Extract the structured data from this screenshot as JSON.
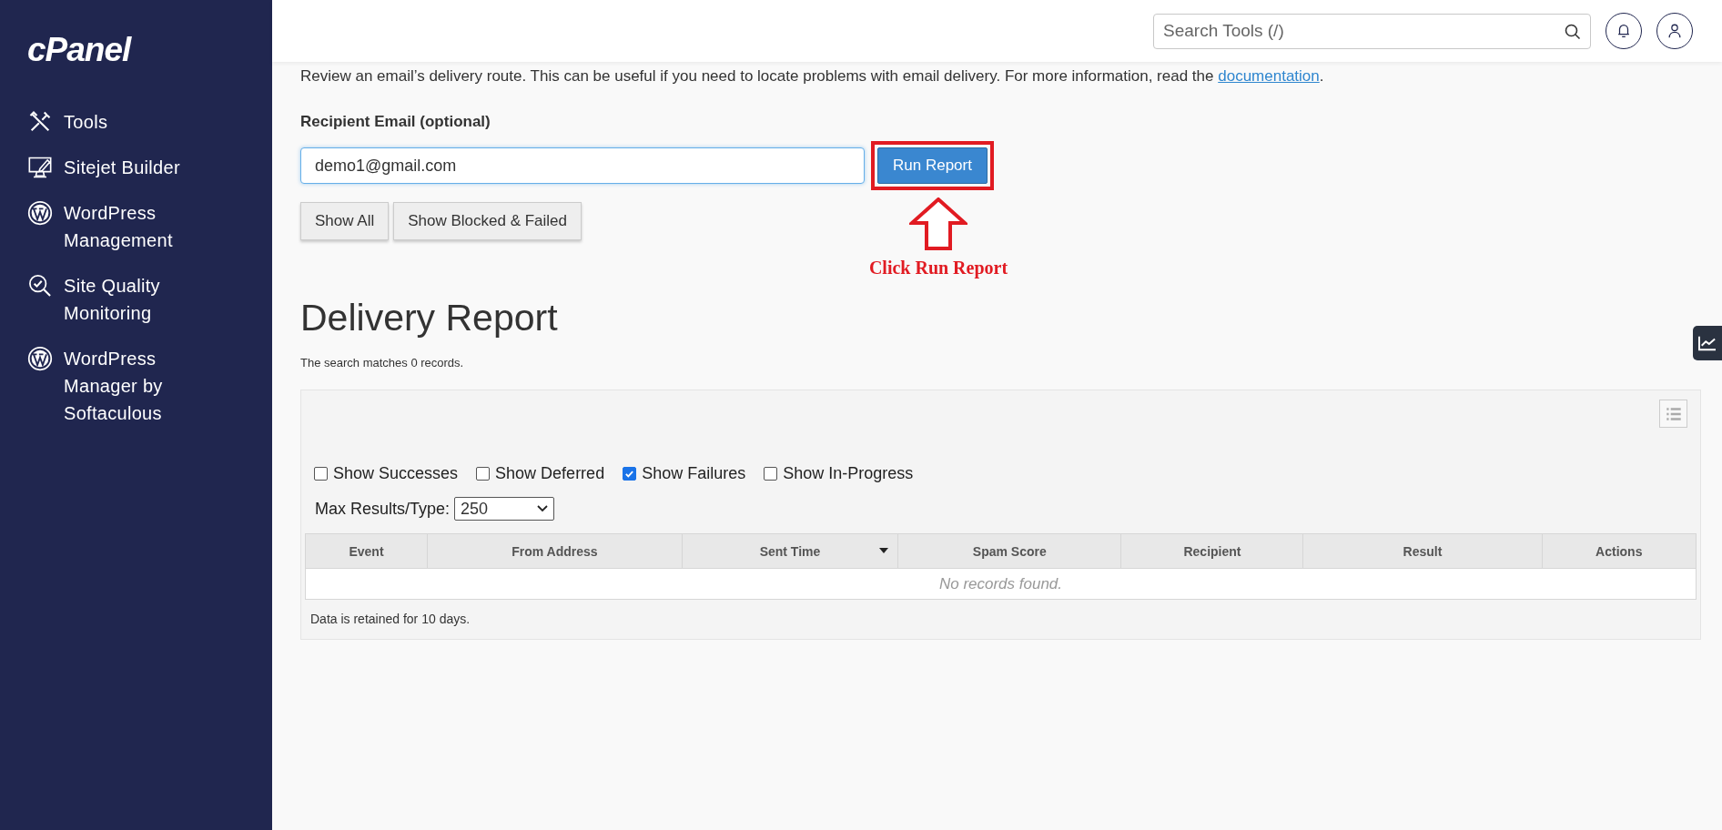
{
  "sidebar": {
    "logo": "cPanel",
    "items": [
      {
        "label": "Tools"
      },
      {
        "label": "Sitejet Builder"
      },
      {
        "label": "WordPress Management"
      },
      {
        "label": "Site Quality Monitoring"
      },
      {
        "label": "WordPress Manager by Softaculous"
      }
    ]
  },
  "header": {
    "search": {
      "placeholder": "Search Tools (/)"
    }
  },
  "description": {
    "text": "Review an email’s delivery route. This can be useful if you need to locate problems with email delivery. For more information, read the ",
    "link": "documentation",
    "after": "."
  },
  "recipient": {
    "label": "Recipient Email (optional)",
    "value": "demo1@gmail.com",
    "button": "Run Report"
  },
  "annotation": {
    "text": "Click Run Report"
  },
  "filter_buttons": [
    "Show All",
    "Show Blocked & Failed"
  ],
  "report": {
    "title": "Delivery Report",
    "summary": "The search matches 0 records.",
    "filters": [
      {
        "label": "Show Successes",
        "checked": false
      },
      {
        "label": "Show Deferred",
        "checked": false
      },
      {
        "label": "Show Failures",
        "checked": true
      },
      {
        "label": "Show In-Progress",
        "checked": false
      }
    ],
    "max_results": {
      "label": "Max Results/Type:",
      "value": "250"
    },
    "columns": [
      {
        "label": "Event",
        "sorted": false
      },
      {
        "label": "From Address",
        "sorted": false
      },
      {
        "label": "Sent Time",
        "sorted": true
      },
      {
        "label": "Spam Score",
        "sorted": false
      },
      {
        "label": "Recipient",
        "sorted": false
      },
      {
        "label": "Result",
        "sorted": false
      },
      {
        "label": "Actions",
        "sorted": false
      }
    ],
    "empty": "No records found.",
    "retention": "Data is retained for 10 days."
  }
}
